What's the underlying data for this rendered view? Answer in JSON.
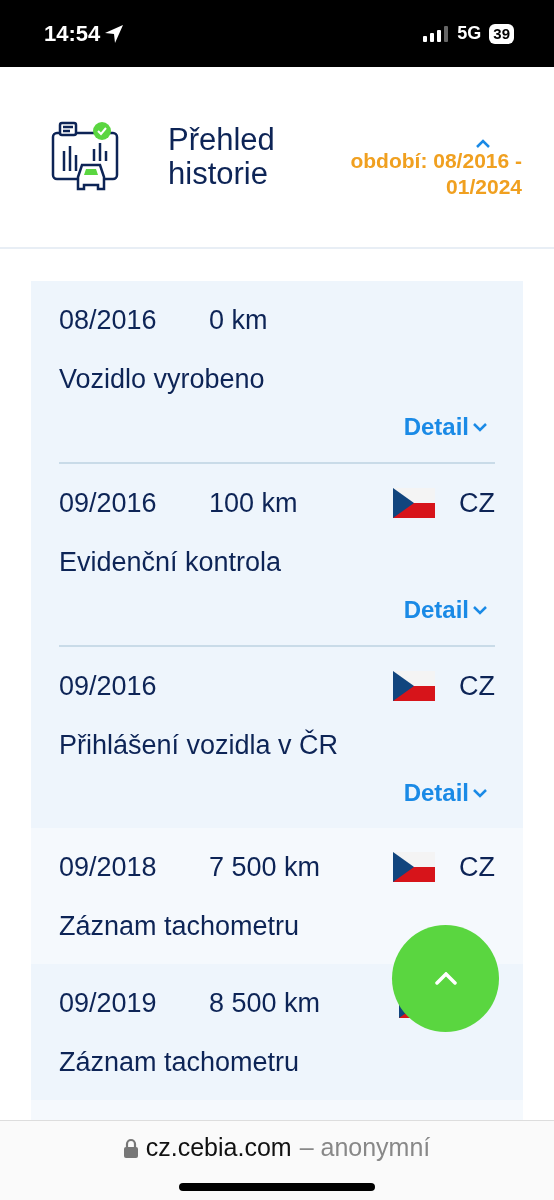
{
  "status_bar": {
    "time": "14:54",
    "network": "5G",
    "battery": "39"
  },
  "header": {
    "title": "Přehled historie",
    "period": "období: 08/2016 - 01/2024"
  },
  "records": [
    {
      "date": "08/2016",
      "mileage": "0 km",
      "flag": false,
      "title": "Vozidlo vyrobeno",
      "detail": "Detail",
      "highlighted": false
    },
    {
      "date": "09/2016",
      "mileage": "100 km",
      "flag": true,
      "country": "CZ",
      "title": "Evidenční kontrola",
      "detail": "Detail",
      "highlighted": false
    },
    {
      "date": "09/2016",
      "flag": true,
      "country": "CZ",
      "title": "Přihlášení vozidla v ČR",
      "detail": "Detail",
      "highlighted": false
    },
    {
      "date": "09/2018",
      "mileage": "7 500 km",
      "flag": true,
      "country": "CZ",
      "title": "Záznam tachometru",
      "highlighted": true
    },
    {
      "date": "09/2019",
      "mileage": "8 500 km",
      "flag": true,
      "title": "Záznam tachometru",
      "highlighted": false
    }
  ],
  "browser_bar": {
    "domain": "cz.cebia.com",
    "suffix": "– anonymní"
  }
}
